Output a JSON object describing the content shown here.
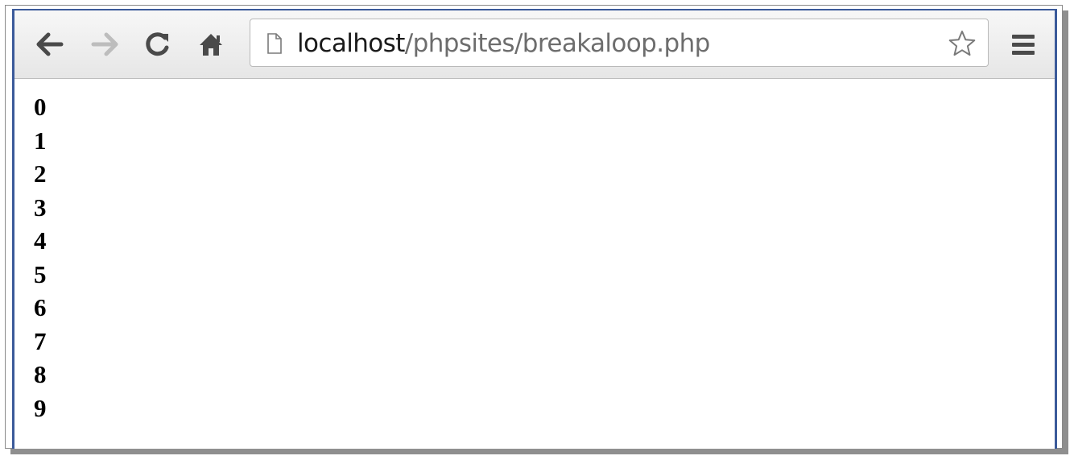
{
  "browser": {
    "url_host": "localhost",
    "url_path": "/phpsites/breakaloop.php"
  },
  "icons": {
    "back": "arrow-left-icon",
    "forward": "arrow-right-icon",
    "reload": "reload-icon",
    "home": "home-icon",
    "page": "page-icon",
    "bookmark": "star-icon",
    "menu": "hamburger-menu-icon"
  },
  "colors": {
    "window_border": "#3b5a9a",
    "toolbar_top": "#f7f7f7",
    "toolbar_bottom": "#e6e6e6",
    "host_text": "#1a1a1a",
    "path_text": "#6d6d6d"
  },
  "page": {
    "lines": [
      "0",
      "1",
      "2",
      "3",
      "4",
      "5",
      "6",
      "7",
      "8",
      "9"
    ]
  }
}
